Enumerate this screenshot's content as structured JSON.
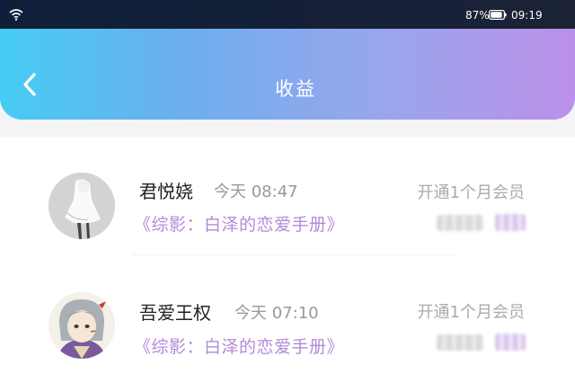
{
  "status_bar": {
    "icon": "wifi-icon",
    "battery_percent": "87%",
    "battery_icon": "battery-icon",
    "time": "09:19"
  },
  "header": {
    "back_icon": "back-arrow-icon",
    "title": "收益"
  },
  "colors": {
    "header_gradient": [
      "#46cdf3",
      "#98a6ec",
      "#bc90ea"
    ],
    "book_title": "#b38ad9",
    "muted_text": "#999999"
  },
  "records": [
    {
      "name": "君悦娆",
      "time": "今天 08:47",
      "action": "开通1个月会员",
      "book": "《综影：白泽的恋爱手册》",
      "avatar": "avatar-image"
    },
    {
      "name": "吾爱王权",
      "time": "今天 07:10",
      "action": "开通1个月会员",
      "book": "《综影：白泽的恋爱手册》",
      "avatar": "avatar-image"
    }
  ]
}
